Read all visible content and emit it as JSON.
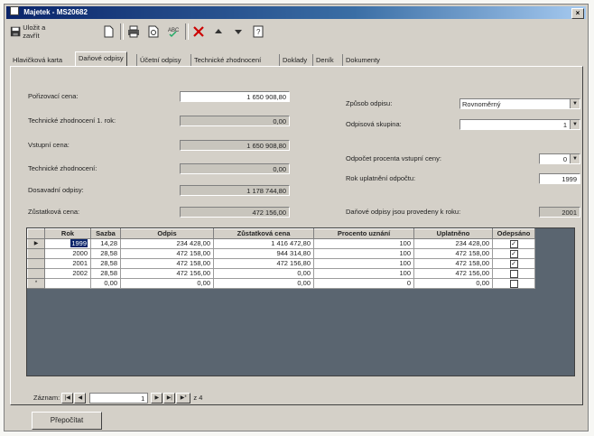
{
  "window": {
    "title": "Majetek - MS20682",
    "close_symbol": "×"
  },
  "toolbar": {
    "save_close_label": "Uložit a zavřít",
    "icons": [
      "save-icon",
      "new-icon",
      "print-icon",
      "print-preview-icon",
      "spellcheck-icon",
      "delete-icon",
      "up-arrow-icon",
      "down-arrow-icon",
      "help-icon"
    ]
  },
  "tabs": [
    {
      "label": "Hlavičková karta"
    },
    {
      "label": "Daňové odpisy",
      "active": true
    },
    {
      "label": "Účetní odpisy"
    },
    {
      "label": "Technické zhodnocení"
    },
    {
      "label": "Doklady"
    },
    {
      "label": "Deník"
    },
    {
      "label": "Dokumenty"
    }
  ],
  "form": {
    "porizovaci_cena": {
      "label": "Pořizovací cena:",
      "value": "1 650 908,80"
    },
    "tz_1_rok": {
      "label": "Technické zhodnocení 1. rok:",
      "value": "0,00"
    },
    "vstupni_cena": {
      "label": "Vstupní cena:",
      "value": "1 650 908,80"
    },
    "tz": {
      "label": "Technické zhodnocení:",
      "value": "0,00"
    },
    "dosavadni_odpisy": {
      "label": "Dosavadní odpisy:",
      "value": "1 178 744,80"
    },
    "zustatkova_cena": {
      "label": "Zůstatková cena:",
      "value": "472 156,00"
    },
    "zpusob_odpisu": {
      "label": "Způsob odpisu:",
      "value": "Rovnoměrný"
    },
    "odpisova_skupina": {
      "label": "Odpisová skupina:",
      "value": "1"
    },
    "procento_vstupni_ceny": {
      "label": "Odpočet procenta vstupní ceny:",
      "value": "0"
    },
    "rok_uplatneni": {
      "label": "Rok uplatnění odpočtu:",
      "value": "1999"
    },
    "provedeny_k_roku": {
      "label": "Daňové odpisy jsou provedeny k roku:",
      "value": "2001"
    }
  },
  "grid": {
    "columns": [
      "Rok",
      "Sazba",
      "Odpis",
      "Zůstatková cena",
      "Procento uznání",
      "Uplatněno",
      "Odepsáno"
    ],
    "rows": [
      {
        "rok": "1999",
        "sazba": "14,28",
        "odpis": "234 428,00",
        "zustatek": "1 416 472,80",
        "procento": "100",
        "uplatneno": "234 428,00",
        "odepsano": true,
        "current": true
      },
      {
        "rok": "2000",
        "sazba": "28,58",
        "odpis": "472 158,00",
        "zustatek": "944 314,80",
        "procento": "100",
        "uplatneno": "472 158,00",
        "odepsano": true
      },
      {
        "rok": "2001",
        "sazba": "28,58",
        "odpis": "472 158,00",
        "zustatek": "472 156,80",
        "procento": "100",
        "uplatneno": "472 158,00",
        "odepsano": true
      },
      {
        "rok": "2002",
        "sazba": "28,58",
        "odpis": "472 156,00",
        "zustatek": "0,00",
        "procento": "100",
        "uplatneno": "472 156,00",
        "odepsano": false
      },
      {
        "rok": "",
        "sazba": "0,00",
        "odpis": "0,00",
        "zustatek": "0,00",
        "procento": "0",
        "uplatneno": "0,00",
        "odepsano": false,
        "new": true
      }
    ]
  },
  "navigator": {
    "label": "Záznam:",
    "current": "1",
    "total_text": "z 4"
  },
  "buttons": {
    "recalculate": "Přepočítat"
  }
}
